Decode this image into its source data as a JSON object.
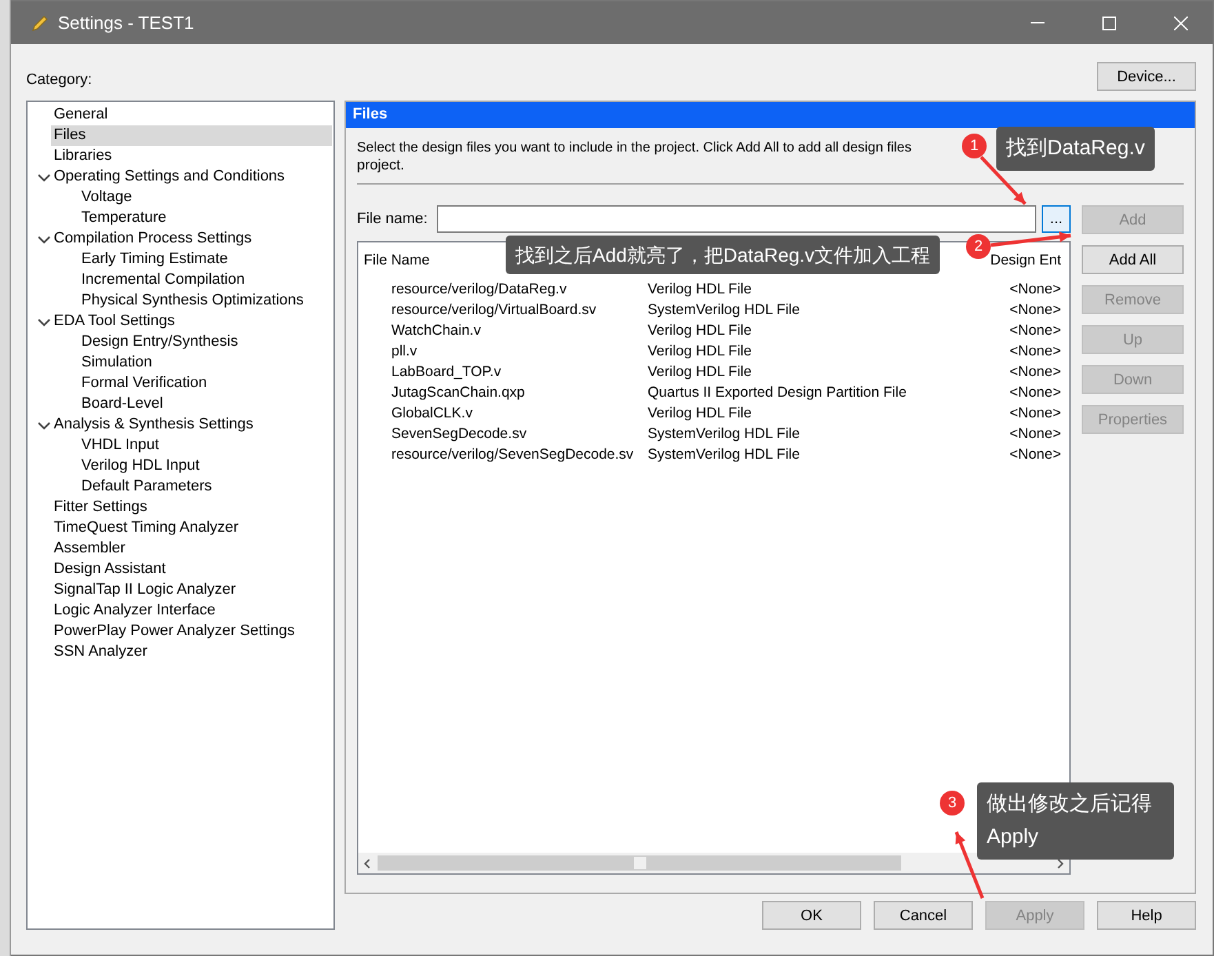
{
  "window": {
    "title": "Settings - TEST1"
  },
  "category_label": "Category:",
  "device_button": "Device...",
  "tree": [
    {
      "label": "General",
      "selected": false
    },
    {
      "label": "Files",
      "selected": true
    },
    {
      "label": "Libraries",
      "selected": false
    },
    {
      "label": "Operating Settings and Conditions",
      "selected": false,
      "expanded": true,
      "children": [
        {
          "label": "Voltage",
          "selected": false
        },
        {
          "label": "Temperature",
          "selected": false
        }
      ]
    },
    {
      "label": "Compilation Process Settings",
      "selected": false,
      "expanded": true,
      "children": [
        {
          "label": "Early Timing Estimate",
          "selected": false
        },
        {
          "label": "Incremental Compilation",
          "selected": false
        },
        {
          "label": "Physical Synthesis Optimizations",
          "selected": false
        }
      ]
    },
    {
      "label": "EDA Tool Settings",
      "selected": false,
      "expanded": true,
      "children": [
        {
          "label": "Design Entry/Synthesis",
          "selected": false
        },
        {
          "label": "Simulation",
          "selected": false
        },
        {
          "label": "Formal Verification",
          "selected": false
        },
        {
          "label": "Board-Level",
          "selected": false
        }
      ]
    },
    {
      "label": "Analysis & Synthesis Settings",
      "selected": false,
      "expanded": true,
      "children": [
        {
          "label": "VHDL Input",
          "selected": false
        },
        {
          "label": "Verilog HDL Input",
          "selected": false
        },
        {
          "label": "Default Parameters",
          "selected": false
        }
      ]
    },
    {
      "label": "Fitter Settings",
      "selected": false
    },
    {
      "label": "TimeQuest Timing Analyzer",
      "selected": false
    },
    {
      "label": "Assembler",
      "selected": false
    },
    {
      "label": "Design Assistant",
      "selected": false
    },
    {
      "label": "SignalTap II Logic Analyzer",
      "selected": false
    },
    {
      "label": "Logic Analyzer Interface",
      "selected": false
    },
    {
      "label": "PowerPlay Power Analyzer Settings",
      "selected": false
    },
    {
      "label": "SSN Analyzer",
      "selected": false
    }
  ],
  "panel": {
    "title": "Files",
    "description_line_1": "Select the design files you want to include in the project. Click Add All to add all design files",
    "description_line_2": "project.",
    "file_name": {
      "label": "File name:"
    },
    "browse_button": "...",
    "columns": [
      "File Name",
      "Design Ent"
    ],
    "rows": [
      {
        "name": "resource/verilog/DataReg.v",
        "type": "Verilog HDL File",
        "design_entry": "<None>"
      },
      {
        "name": "resource/verilog/VirtualBoard.sv",
        "type": "SystemVerilog HDL File",
        "design_entry": "<None>"
      },
      {
        "name": "WatchChain.v",
        "type": "Verilog HDL File",
        "design_entry": "<None>"
      },
      {
        "name": "pll.v",
        "type": "Verilog HDL File",
        "design_entry": "<None>"
      },
      {
        "name": "LabBoard_TOP.v",
        "type": "Verilog HDL File",
        "design_entry": "<None>"
      },
      {
        "name": "JutagScanChain.qxp",
        "type": "Quartus II Exported Design Partition File",
        "design_entry": "<None>"
      },
      {
        "name": "GlobalCLK.v",
        "type": "Verilog HDL File",
        "design_entry": "<None>"
      },
      {
        "name": "SevenSegDecode.sv",
        "type": "SystemVerilog HDL File",
        "design_entry": "<None>"
      },
      {
        "name": "resource/verilog/SevenSegDecode.sv",
        "type": "SystemVerilog HDL File",
        "design_entry": "<None>"
      }
    ],
    "side_buttons": [
      {
        "label": "Add",
        "disabled": true
      },
      {
        "label": "Add All",
        "disabled": false
      },
      {
        "label": "Remove",
        "disabled": true
      },
      {
        "label": "Up",
        "disabled": true
      },
      {
        "label": "Down",
        "disabled": true
      },
      {
        "label": "Properties",
        "disabled": true
      }
    ]
  },
  "footer_buttons": [
    {
      "label": "OK",
      "disabled": false
    },
    {
      "label": "Cancel",
      "disabled": false
    },
    {
      "label": "Apply",
      "disabled": true
    },
    {
      "label": "Help",
      "disabled": false
    }
  ],
  "callouts": [
    {
      "number": "1",
      "text": "找到DataReg.v"
    },
    {
      "number": "2",
      "text": "找到之后Add就亮了，把DataReg.v文件加入工程"
    },
    {
      "number": "3",
      "text": "做出修改之后记得Apply"
    }
  ]
}
